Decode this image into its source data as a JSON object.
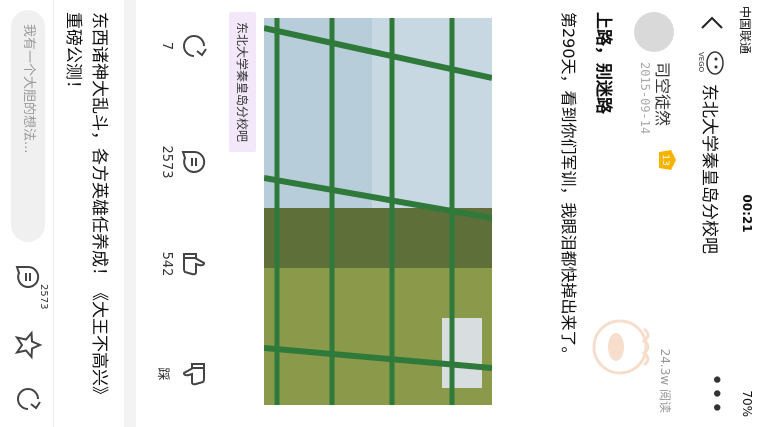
{
  "status": {
    "carrier": "中国联通",
    "time": "00:21",
    "battery": "70%"
  },
  "topbar": {
    "title": "东北大学秦皇岛分校吧",
    "more": "•••"
  },
  "author": {
    "name": "司空徒然",
    "level": "13",
    "date": "2015-09-14",
    "reads": "24.3w 阅读"
  },
  "post": {
    "title": "上路，别迷路",
    "body": "第290天，看到你们军训，我眼泪都快掉出来了。",
    "tag": "东北大学秦皇岛分校吧"
  },
  "actions": {
    "share_count": "7",
    "comment_count": "2573",
    "like_count": "542",
    "dislike_label": "踩"
  },
  "next_post": {
    "title": "东西诸神大乱斗，各方英雄任养成！《大王不高兴》重磅公测！"
  },
  "bottombar": {
    "placeholder": "我有一个大胆的想法...",
    "comment_badge": "2573"
  },
  "colors": {
    "tag_bg": "#f2e8fa",
    "grass": "#8a9a4a",
    "fence": "#2f7a3a"
  }
}
